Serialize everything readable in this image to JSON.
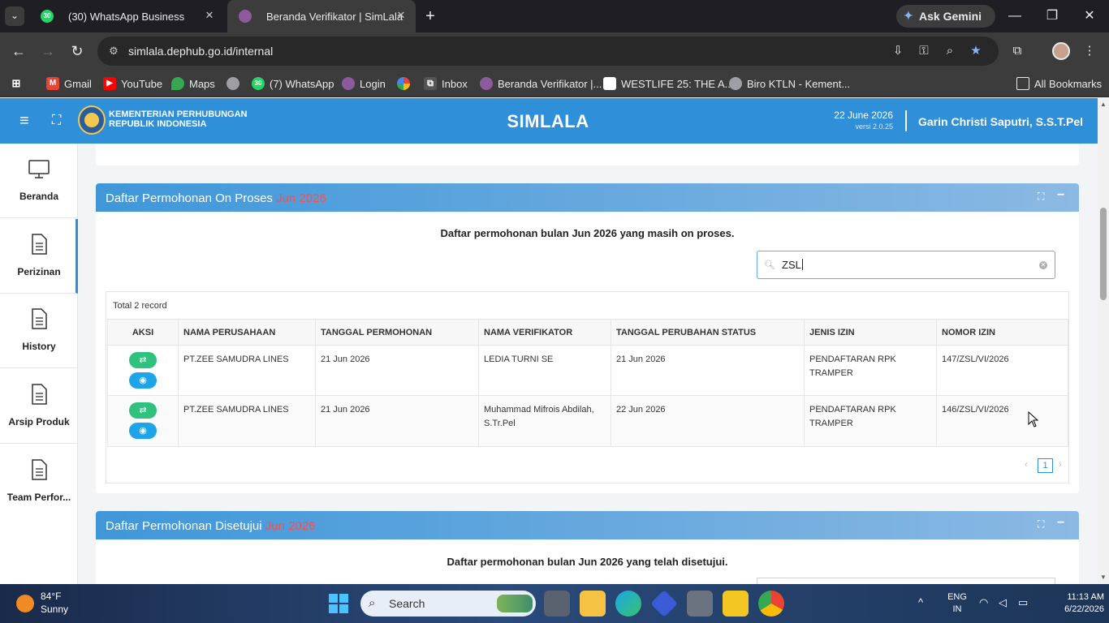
{
  "browser": {
    "tabs": [
      {
        "title": "(30) WhatsApp Business",
        "favicon_badge": "30",
        "active": false
      },
      {
        "title": "Beranda Verifikator | SimLala",
        "active": true
      }
    ],
    "gemini_label": "Ask Gemini",
    "url": "simlala.dephub.go.id/internal",
    "bookmarks": [
      {
        "label": "Gmail",
        "icon": "gmail-icon",
        "color": "#ea4335"
      },
      {
        "label": "YouTube",
        "icon": "youtube-icon",
        "color": "#ff0000"
      },
      {
        "label": "Maps",
        "icon": "maps-icon",
        "color": "#34a853"
      },
      {
        "label": "",
        "icon": "globe-icon",
        "color": "#9aa0a6"
      },
      {
        "label": "(7) WhatsApp",
        "icon": "whatsapp-icon",
        "color": "#25d366",
        "badge": "30"
      },
      {
        "label": "Login",
        "icon": "simlala-icon",
        "color": "#8e5a9e"
      },
      {
        "label": "",
        "icon": "pinwheel-icon",
        "color": "#fbbc05"
      },
      {
        "label": "Inbox",
        "icon": "inbox-icon",
        "color": "#555555"
      },
      {
        "label": "Beranda Verifikator |...",
        "icon": "simlala-icon",
        "color": "#8e5a9e"
      },
      {
        "label": "WESTLIFE 25: THE A...",
        "icon": "page-icon",
        "color": "#ffffff"
      },
      {
        "label": "Biro KTLN - Kement...",
        "icon": "globe-icon",
        "color": "#9aa0a6"
      }
    ],
    "all_bookmarks_label": "All Bookmarks"
  },
  "header": {
    "ministry_line1": "KEMENTERIAN PERHUBUNGAN",
    "ministry_line2": "REPUBLIK INDONESIA",
    "app_title": "SIMLALA",
    "date": "22 June 2026",
    "version": "versi 2.0.25",
    "user": "Garin Christi Saputri, S.S.T.Pel"
  },
  "sidebar": {
    "items": [
      {
        "label": "Beranda",
        "icon": "monitor-icon",
        "active": false
      },
      {
        "label": "Perizinan",
        "icon": "document-icon",
        "active": true
      },
      {
        "label": "History",
        "icon": "document-icon",
        "active": false
      },
      {
        "label": "Arsip Produk",
        "icon": "document-icon",
        "active": false
      },
      {
        "label": "Team Perfor...",
        "icon": "document-icon",
        "active": false
      }
    ]
  },
  "on_process": {
    "title": "Daftar Permohonan On Proses",
    "month": "Jun 2026",
    "description": "Daftar permohonan bulan Jun 2026 yang masih on proses.",
    "search_value": "ZSL",
    "total_label": "Total 2 record",
    "columns": [
      "AKSI",
      "NAMA PERUSAHAAN",
      "TANGGAL PERMOHONAN",
      "NAMA VERIFIKATOR",
      "TANGGAL PERUBAHAN STATUS",
      "JENIS IZIN",
      "NOMOR IZIN"
    ],
    "rows": [
      {
        "company": "PT.ZEE SAMUDRA LINES",
        "request_date": "21 Jun 2026",
        "verifier": "LEDIA TURNI SE",
        "status_date": "21 Jun 2026",
        "permit_type": "PENDAFTARAN RPK TRAMPER",
        "permit_no": "147/ZSL/VI/2026"
      },
      {
        "company": "PT.ZEE SAMUDRA LINES",
        "request_date": "21 Jun 2026",
        "verifier": "Muhammad Mifrois Abdilah, S.Tr.Pel",
        "status_date": "22 Jun 2026",
        "permit_type": "PENDAFTARAN RPK TRAMPER",
        "permit_no": "146/ZSL/VI/2026"
      }
    ],
    "page": "1"
  },
  "approved": {
    "title": "Daftar Permohonan Disetujui",
    "month": "Jun 2026",
    "description": "Daftar permohonan bulan Jun 2026 yang telah disetujui."
  },
  "taskbar": {
    "temperature": "84°F",
    "condition": "Sunny",
    "search_label": "Search",
    "lang_line1": "ENG",
    "lang_line2": "IN",
    "time": "11:13 AM",
    "date": "6/22/2026"
  },
  "colors": {
    "header_blue": "#2f8fd8",
    "month_red": "#ff4d4d",
    "switch_green": "#2ec27e",
    "view_blue": "#1ea5e9"
  }
}
